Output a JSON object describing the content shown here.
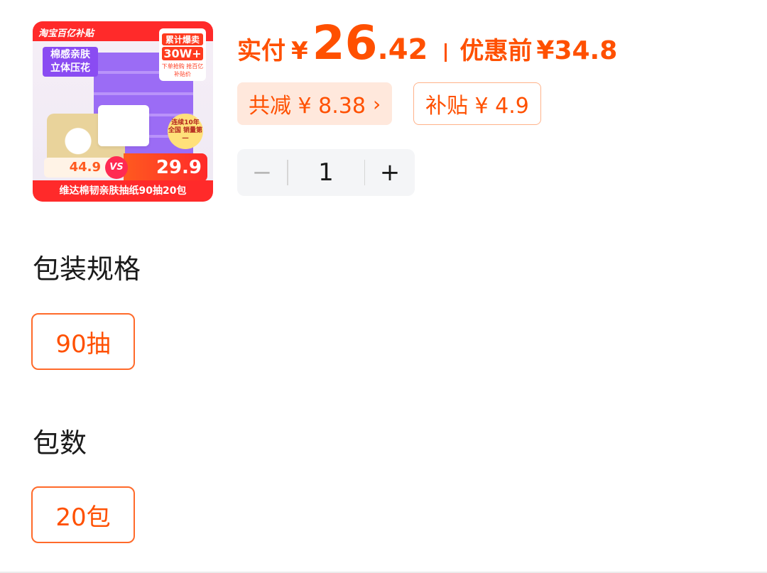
{
  "product_image": {
    "banner": "淘宝百亿补贴",
    "slogan": "棉感亲肤 立体压花",
    "sales_badge_line1": "累计爆卖",
    "sales_badge_line2": "30W+",
    "sales_badge_line3": "下单抢购 抢百亿补贴价",
    "rank_badge": "连续10年 全国 销量第一",
    "compare_old_price": "44.9",
    "compare_vs": "VS",
    "compare_new_price": "29.9",
    "caption": "维达棉韧亲肤抽纸90抽20包"
  },
  "price": {
    "pay_label": "实付",
    "currency": "¥",
    "pay_int": "26",
    "pay_dec": ".42",
    "before_label": "优惠前",
    "before_value": "¥34.8"
  },
  "discount_chips": {
    "reduce_label": "共减 ¥ 8.38",
    "reduce_arrow": "›",
    "subsidy_label": "补贴 ¥ 4.9"
  },
  "stepper": {
    "minus": "−",
    "quantity": "1",
    "plus": "+"
  },
  "spec_sections": {
    "packaging_title": "包装规格",
    "packaging_option": "90抽",
    "count_title": "包数",
    "count_option": "20包"
  },
  "colors": {
    "accent": "#ff5000",
    "chip_bg": "#ffe8dc",
    "stepper_bg": "#f4f5f7",
    "banner_red": "#ff2a2a"
  }
}
